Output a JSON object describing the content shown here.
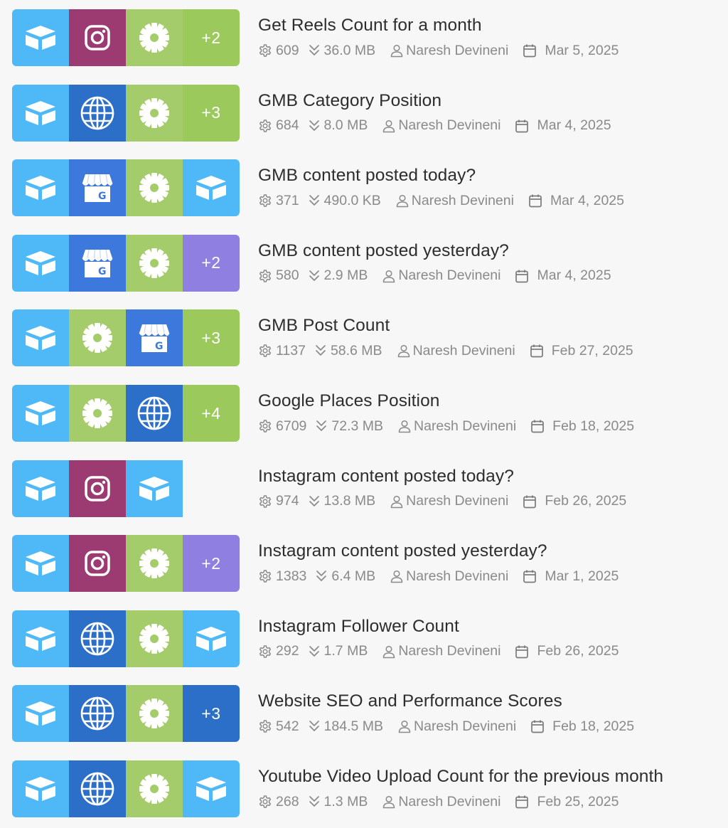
{
  "colors": {
    "airtable": "#4fb9f7",
    "instagram": "#9c3a72",
    "settings": "#a5cc6b",
    "globe": "#2c6fc8",
    "gmb": "#3d79dd",
    "more_green": "#9bc95c",
    "more_purple": "#8e7fe0",
    "more_blue": "#2b6fc8",
    "title_text": "#2d2d2d",
    "meta_text": "#8a8a8a",
    "background": "#f7f7f7"
  },
  "workflows": [
    {
      "title": "Get Reels Count for a month",
      "tiles": [
        {
          "icon": "airtable-icon"
        },
        {
          "icon": "instagram-icon"
        },
        {
          "icon": "gear-icon"
        },
        {
          "more": "+2",
          "color": "more_green"
        }
      ],
      "runs": "609",
      "size": "36.0 MB",
      "author": "Naresh Devineni",
      "date": "Mar 5, 2025"
    },
    {
      "title": "GMB Category Position",
      "tiles": [
        {
          "icon": "airtable-icon"
        },
        {
          "icon": "globe-icon"
        },
        {
          "icon": "gear-icon"
        },
        {
          "more": "+3",
          "color": "more_green"
        }
      ],
      "runs": "684",
      "size": "8.0 MB",
      "author": "Naresh Devineni",
      "date": "Mar 4, 2025"
    },
    {
      "title": "GMB content posted today?",
      "tiles": [
        {
          "icon": "airtable-icon"
        },
        {
          "icon": "google-my-business-icon"
        },
        {
          "icon": "gear-icon"
        },
        {
          "icon": "airtable-icon"
        }
      ],
      "runs": "371",
      "size": "490.0 KB",
      "author": "Naresh Devineni",
      "date": "Mar 4, 2025"
    },
    {
      "title": "GMB content posted yesterday?",
      "tiles": [
        {
          "icon": "airtable-icon"
        },
        {
          "icon": "google-my-business-icon"
        },
        {
          "icon": "gear-icon"
        },
        {
          "more": "+2",
          "color": "more_purple"
        }
      ],
      "runs": "580",
      "size": "2.9 MB",
      "author": "Naresh Devineni",
      "date": "Mar 4, 2025"
    },
    {
      "title": "GMB Post Count",
      "tiles": [
        {
          "icon": "airtable-icon"
        },
        {
          "icon": "gear-icon"
        },
        {
          "icon": "google-my-business-icon"
        },
        {
          "more": "+3",
          "color": "more_green"
        }
      ],
      "runs": "1137",
      "size": "58.6 MB",
      "author": "Naresh Devineni",
      "date": "Feb 27, 2025"
    },
    {
      "title": "Google Places Position",
      "tiles": [
        {
          "icon": "airtable-icon"
        },
        {
          "icon": "gear-icon"
        },
        {
          "icon": "globe-icon"
        },
        {
          "more": "+4",
          "color": "more_green"
        }
      ],
      "runs": "6709",
      "size": "72.3 MB",
      "author": "Naresh Devineni",
      "date": "Feb 18, 2025"
    },
    {
      "title": "Instagram content posted today?",
      "tiles": [
        {
          "icon": "airtable-icon"
        },
        {
          "icon": "instagram-icon"
        },
        {
          "icon": "airtable-icon"
        }
      ],
      "runs": "974",
      "size": "13.8 MB",
      "author": "Naresh Devineni",
      "date": "Feb 26, 2025"
    },
    {
      "title": "Instagram content posted yesterday?",
      "tiles": [
        {
          "icon": "airtable-icon"
        },
        {
          "icon": "instagram-icon"
        },
        {
          "icon": "gear-icon"
        },
        {
          "more": "+2",
          "color": "more_purple"
        }
      ],
      "runs": "1383",
      "size": "6.4 MB",
      "author": "Naresh Devineni",
      "date": "Mar 1, 2025"
    },
    {
      "title": "Instagram Follower Count",
      "tiles": [
        {
          "icon": "airtable-icon"
        },
        {
          "icon": "globe-icon"
        },
        {
          "icon": "gear-icon"
        },
        {
          "icon": "airtable-icon"
        }
      ],
      "runs": "292",
      "size": "1.7 MB",
      "author": "Naresh Devineni",
      "date": "Feb 26, 2025"
    },
    {
      "title": "Website SEO and Performance Scores",
      "tiles": [
        {
          "icon": "airtable-icon"
        },
        {
          "icon": "globe-icon"
        },
        {
          "icon": "gear-icon"
        },
        {
          "more": "+3",
          "color": "more_blue"
        }
      ],
      "runs": "542",
      "size": "184.5 MB",
      "author": "Naresh Devineni",
      "date": "Feb 18, 2025"
    },
    {
      "title": "Youtube Video Upload Count for the previous month",
      "tiles": [
        {
          "icon": "airtable-icon"
        },
        {
          "icon": "globe-icon"
        },
        {
          "icon": "gear-icon"
        },
        {
          "icon": "airtable-icon"
        }
      ],
      "runs": "268",
      "size": "1.3 MB",
      "author": "Naresh Devineni",
      "date": "Feb 25, 2025"
    }
  ]
}
